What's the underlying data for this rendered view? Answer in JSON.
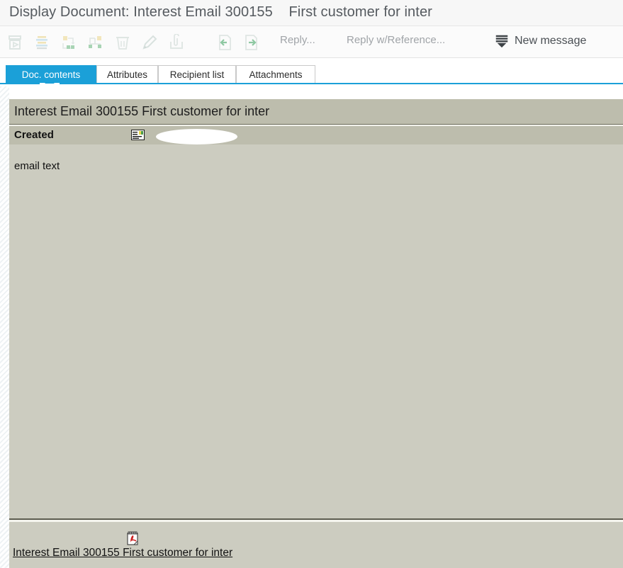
{
  "window": {
    "title": "Display Document: Interest Email 300155    First customer for inter"
  },
  "toolbar": {
    "icons": [
      {
        "name": "print-preview-icon",
        "label": "Print Preview"
      },
      {
        "name": "sort-list-icon",
        "label": "Sort"
      },
      {
        "name": "workflow-export-icon",
        "label": "Workflow Export"
      },
      {
        "name": "workflow-structure-icon",
        "label": "Workflow Structure"
      },
      {
        "name": "delete-trash-icon",
        "label": "Delete"
      },
      {
        "name": "edit-pencil-icon",
        "label": "Change"
      },
      {
        "name": "attachment-clip-icon",
        "label": "Attachment"
      },
      {
        "name": "previous-document-icon",
        "label": "Previous"
      },
      {
        "name": "next-document-icon",
        "label": "Next"
      }
    ],
    "reply_label": "Reply...",
    "reply_with_reference_label": "Reply w/Reference...",
    "new_message_label": "New message",
    "new_message_icon": "new-message-icon"
  },
  "tabs": [
    {
      "label": "Doc. contents",
      "active": true
    },
    {
      "label": "Attributes",
      "active": false
    },
    {
      "label": "Recipient list",
      "active": false
    },
    {
      "label": "Attachments",
      "active": false
    }
  ],
  "document": {
    "title": "Interest Email 300155 First customer for inter",
    "created_label": "Created",
    "created_icon": "document-note-icon",
    "redaction": "",
    "body_text": "email text"
  },
  "attachment": {
    "icon": "pdf-file-icon",
    "link_label": "Interest Email 300155 First customer for inter"
  },
  "colors": {
    "accent_blue": "#1ba0d8",
    "content_bg": "#ccccc0",
    "header_bg": "#bdbdad",
    "title_text": "#555a5f",
    "icon_disabled": "#dfe6e3",
    "icon_green": "#93c9a4",
    "pdf_red": "#cc2222"
  }
}
